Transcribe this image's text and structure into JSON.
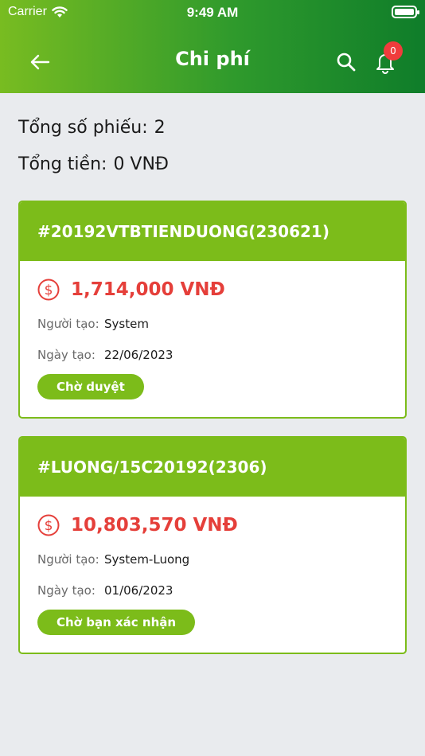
{
  "status_bar": {
    "carrier": "Carrier",
    "time": "9:49 AM"
  },
  "nav": {
    "title": "Chi phí",
    "back_icon": "arrow-left-icon",
    "search_icon": "search-icon",
    "bell_icon": "bell-icon",
    "notification_count": "0"
  },
  "summary": {
    "total_tickets_label": "Tổng số phiếu:",
    "total_tickets_value": "2",
    "total_money_label": "Tổng tiền:",
    "total_money_value": "0 VNĐ"
  },
  "cards": [
    {
      "code": "#20192VTBTIENDUONG(230621)",
      "amount": "1,714,000 VNĐ",
      "creator_label": "Người tạo:",
      "creator": "System",
      "date_label": "Ngày tạo:",
      "date": "22/06/2023",
      "status": "Chờ duyệt"
    },
    {
      "code": "#LUONG/15C20192(2306)",
      "amount": "10,803,570 VNĐ",
      "creator_label": "Người tạo:",
      "creator": "System-Luong",
      "date_label": "Ngày tạo:",
      "date": "01/06/2023",
      "status": "Chờ bạn xác nhận"
    }
  ],
  "colors": {
    "brand_green": "#7cbc1a",
    "header_dark_green": "#0f7d2a",
    "amount_red": "#e53f3a",
    "badge_red": "#f03c3c"
  }
}
